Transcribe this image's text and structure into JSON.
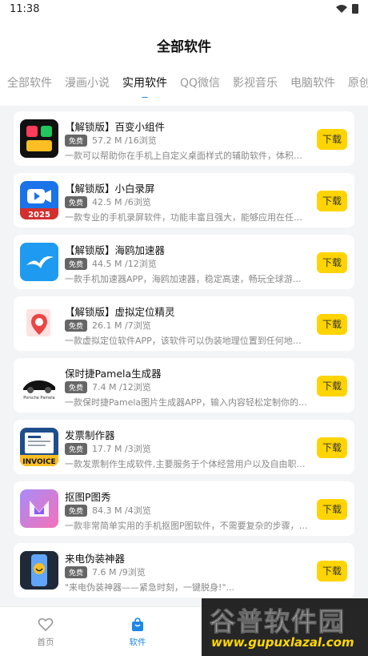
{
  "status": {
    "time": "11:38"
  },
  "title": "全部软件",
  "tabs": [
    "全部软件",
    "漫画小说",
    "实用软件",
    "QQ微信",
    "影视音乐",
    "电脑软件",
    "原创"
  ],
  "active_tab": 2,
  "download_label": "下载",
  "free_label": "免费",
  "apps": [
    {
      "name": "【解锁版】百变小组件",
      "size": "57.2 M",
      "views": "/16浏览",
      "desc": "一款可以帮助你在手机上自定义桌面样式的辅助软件，体积小巧，..."
    },
    {
      "name": "【解锁版】小白录屏",
      "size": "42.5 M",
      "views": "/6浏览",
      "desc": "一款专业的手机录屏软件，功能丰富且强大，能够应用在任何场景..."
    },
    {
      "name": "【解锁版】海鸥加速器",
      "size": "44.5 M",
      "views": "/12浏览",
      "desc": "一款手机加速器APP，海鸥加速器，稳定高速，畅玩全球游戏，一..."
    },
    {
      "name": "【解锁版】虚拟定位精灵",
      "size": "26.1 M",
      "views": "/7浏览",
      "desc": "一款虚拟定位软件APP，该软件可以伪装地理位置到任何地点，也..."
    },
    {
      "name": "保时捷Pamela生成器",
      "size": "7.4 M",
      "views": "/12浏览",
      "desc": "一款保时捷Pamela图片生成器APP，输入内容轻松定制你的专属保..."
    },
    {
      "name": "发票制作器",
      "size": "17.7 M",
      "views": "/3浏览",
      "desc": "一款发票制作生成软件,主要服务于个体经营用户以及自由职业者,..."
    },
    {
      "name": "抠图P图秀",
      "size": "84.3 M",
      "views": "/4浏览",
      "desc": "一款非常简单实用的手机抠图P图软件，不需要复杂的步骤，简简..."
    },
    {
      "name": "来电伪装神器",
      "size": "7.6 M",
      "views": "/9浏览",
      "desc": "\"来电伪装神器——紧急时刻，一键脱身!\"..."
    }
  ],
  "icon_texts": {
    "app2_year": "2025",
    "app5_caption": "Porsche Pamela",
    "app6_caption": "INVOICE"
  },
  "nav": {
    "home": "首页",
    "software": "软件"
  },
  "watermark": {
    "big": "谷普软件园",
    "url": "www.gupuxlazal.com"
  },
  "colors": {
    "accent": "#1e88e5",
    "download_button": "#ffd400"
  }
}
